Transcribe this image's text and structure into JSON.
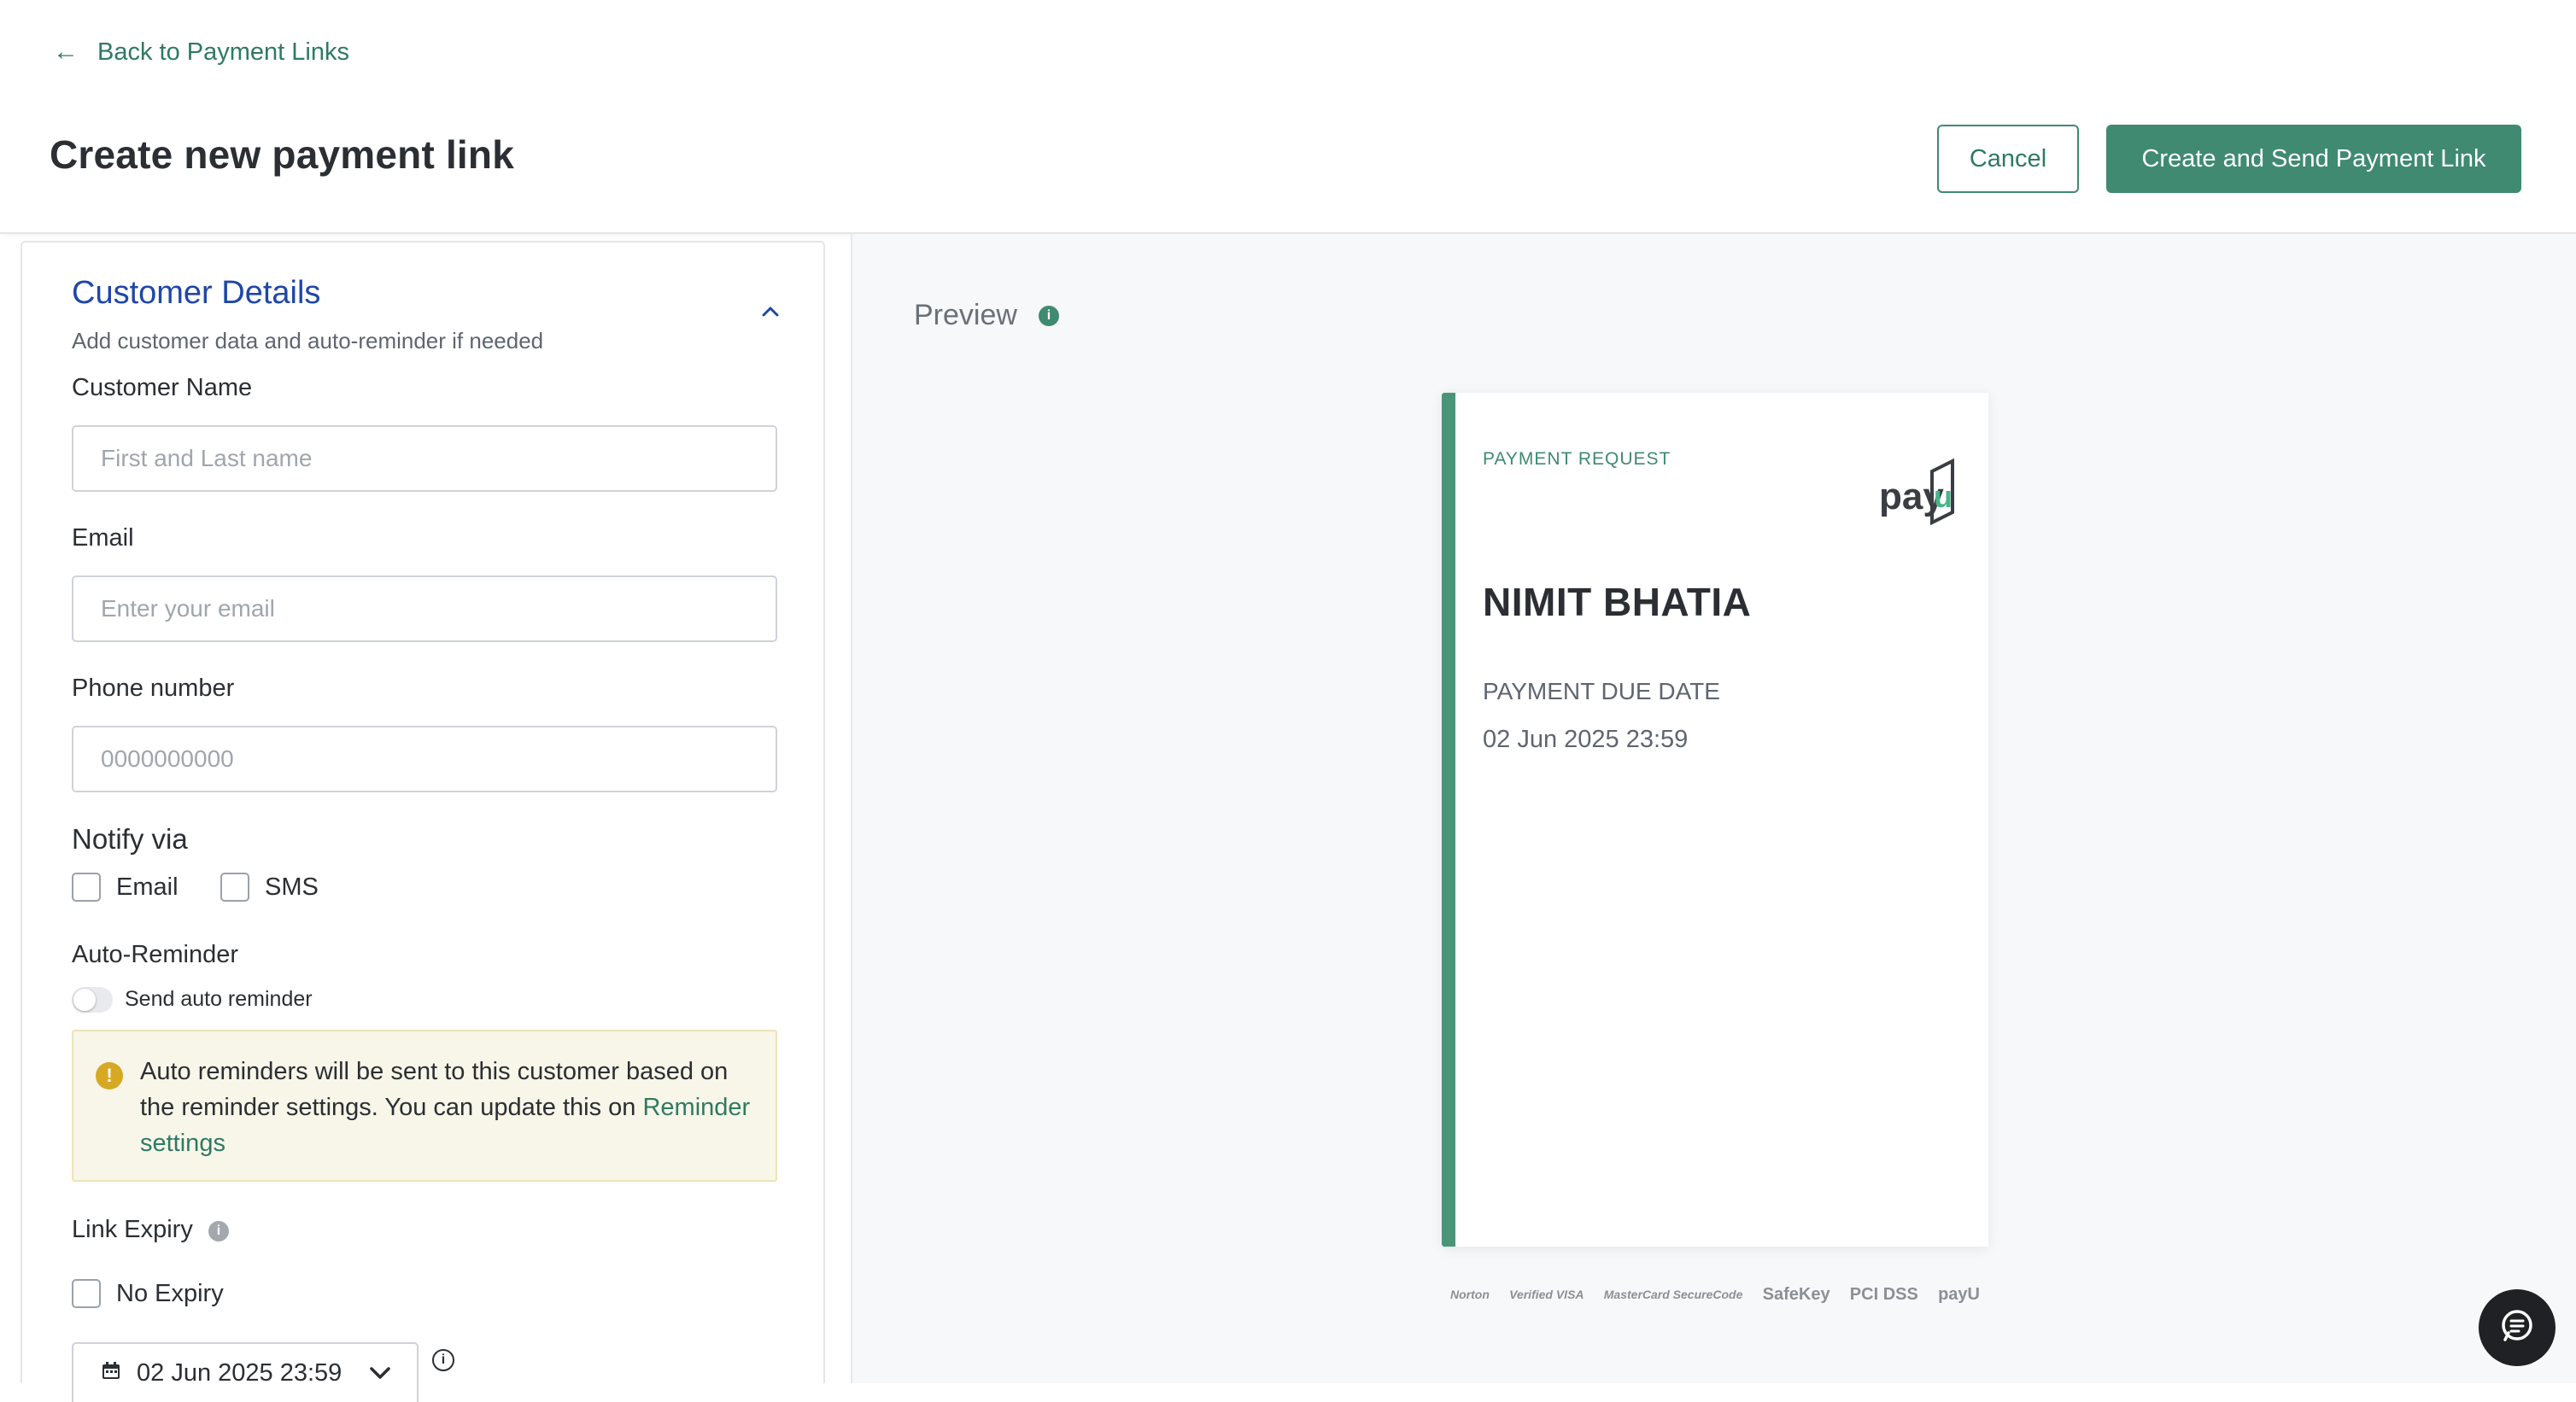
{
  "header": {
    "back_label": "Back to Payment Links",
    "title": "Create new payment link",
    "cancel_label": "Cancel",
    "primary_label": "Create and Send Payment Link"
  },
  "customer_details": {
    "title": "Customer Details",
    "subtitle": "Add customer data and auto-reminder if needed",
    "name": {
      "label": "Customer Name",
      "placeholder": "First and Last name",
      "value": ""
    },
    "email": {
      "label": "Email",
      "placeholder": "Enter your email",
      "value": ""
    },
    "phone": {
      "label": "Phone number",
      "placeholder": "0000000000",
      "value": ""
    }
  },
  "notify": {
    "label": "Notify via",
    "options": [
      {
        "label": "Email",
        "checked": false
      },
      {
        "label": "SMS",
        "checked": false
      }
    ]
  },
  "auto_reminder": {
    "label": "Auto-Reminder",
    "toggle_label": "Send auto reminder",
    "enabled": false,
    "info_text": "Auto reminders will be sent to this customer based on the reminder settings. You can update this on",
    "info_link": "Reminder settings"
  },
  "link_expiry": {
    "label": "Link Expiry",
    "no_expiry_label": "No Expiry",
    "no_expiry_checked": false,
    "date_value": "02 Jun 2025 23:59"
  },
  "preview": {
    "label": "Preview",
    "card": {
      "eyebrow": "PAYMENT REQUEST",
      "logo_text": "payU",
      "customer_name": "NIMIT BHATIA",
      "due_label": "PAYMENT DUE DATE",
      "due_value": "02 Jun 2025 23:59"
    },
    "trust_badges": [
      "Norton",
      "Verified VISA",
      "MasterCard SecureCode",
      "SafeKey",
      "PCI DSS",
      "payU"
    ]
  },
  "colors": {
    "brand": "#3f8a70",
    "section_title": "#1f47a8",
    "warning": "#d6a823",
    "info_bg": "#f8f6e8"
  },
  "icons": {
    "back": "arrow-left-icon",
    "collapse": "chevron-up-icon",
    "warning": "warning-icon",
    "info": "info-icon",
    "calendar": "calendar-icon",
    "chat": "chat-icon"
  }
}
